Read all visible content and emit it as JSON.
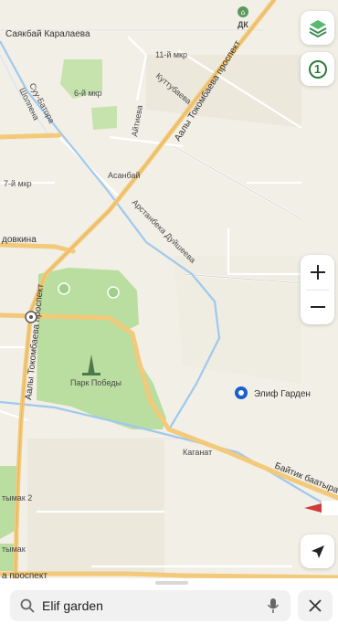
{
  "map": {
    "streets": {
      "sayakbay": "Саякбай Каралаева",
      "suu_batora": "Суу-Батора",
      "sholpena": "Шолпена",
      "mkr_11": "11-й мкр",
      "mkr_6": "6-й мкр",
      "kuttubaeva": "Куттубаева",
      "aitieva": "Айтиева",
      "prospekt_top": "Аалы Токомбаева проспект",
      "asanbay": "Асанбай",
      "mkr_7": "7-й мкр",
      "dyushe": "Арстанбека Дуйшеева",
      "dovkina": "довкина",
      "prospekt_left": "Аалы Токомбаева проспект",
      "kaganat": "Каганат",
      "baytik": "Байтик баатыра",
      "tymak2": "тымак 2",
      "tymak": "тымак",
      "prospekt_bottom": "а проспект"
    },
    "pois": {
      "dk": "ДК",
      "park": "Парк Победы",
      "elif": "Элиф Гарден"
    }
  },
  "controls": {
    "layers_icon": "layers-icon",
    "traffic_level": "1",
    "zoom_in": "+",
    "zoom_out": "−",
    "locate_icon": "navigation-arrow-icon"
  },
  "search": {
    "query": "Elif garden",
    "search_icon": "search-icon",
    "mic_icon": "microphone-icon",
    "close_icon": "close-icon"
  },
  "colors": {
    "main_road": "#f3c97a",
    "park": "#b9dea0",
    "river": "#9ec9ee",
    "pin": "#1a5fcf",
    "badge": "#2f7a3b"
  }
}
